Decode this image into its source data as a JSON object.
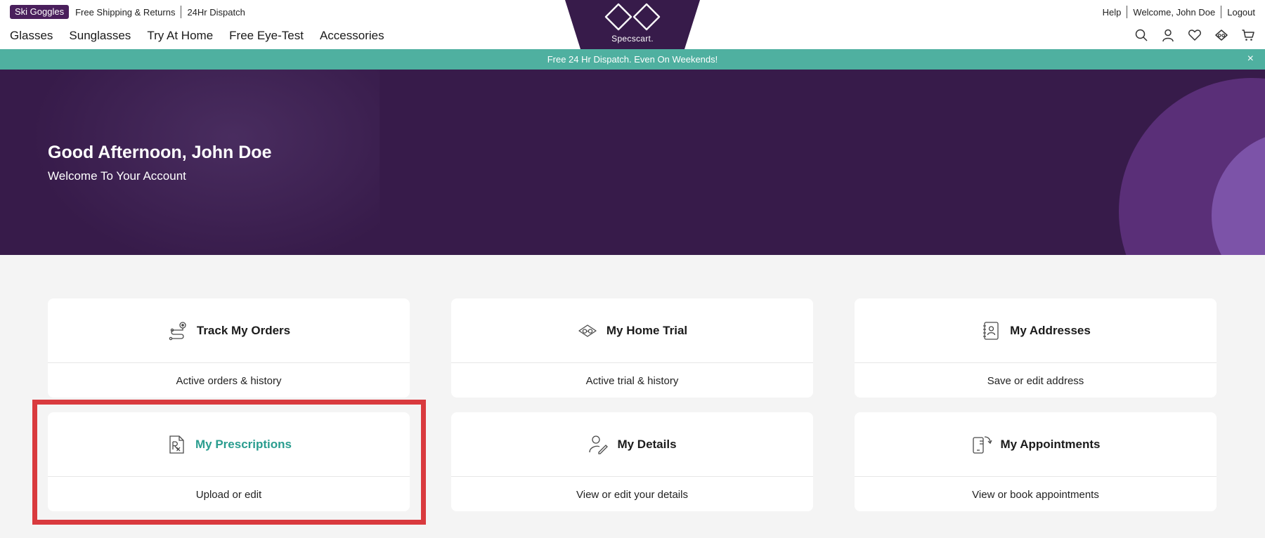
{
  "topbar": {
    "promo_tag": "Ski Goggles",
    "shipping": "Free Shipping & Returns",
    "dispatch": "24Hr Dispatch"
  },
  "topright": {
    "help": "Help",
    "welcome": "Welcome, John Doe",
    "logout": "Logout"
  },
  "nav": [
    "Glasses",
    "Sunglasses",
    "Try At Home",
    "Free Eye-Test",
    "Accessories"
  ],
  "logo": {
    "text": "Specscart."
  },
  "icons": [
    "search-icon",
    "user-icon",
    "heart-icon",
    "home-trial-icon",
    "cart-icon"
  ],
  "announcement": {
    "text": "Free 24 Hr Dispatch. Even On Weekends!",
    "close": "×"
  },
  "hero": {
    "title": "Good Afternoon, John Doe",
    "subtitle": "Welcome To Your Account"
  },
  "cards": [
    {
      "title": "Track My Orders",
      "desc": "Active orders & history",
      "icon": "route-icon"
    },
    {
      "title": "My Home Trial",
      "desc": "Active trial & history",
      "icon": "glasses-box-icon"
    },
    {
      "title": "My Addresses",
      "desc": "Save or edit address",
      "icon": "address-book-icon"
    },
    {
      "title": "My Prescriptions",
      "desc": "Upload or edit",
      "icon": "prescription-icon",
      "active": true
    },
    {
      "title": "My Details",
      "desc": "View or edit your details",
      "icon": "user-edit-icon"
    },
    {
      "title": "My Appointments",
      "desc": "View or book appointments",
      "icon": "phone-calendar-icon"
    }
  ],
  "colors": {
    "brand_purple": "#371b4a",
    "teal": "#4fb0a0",
    "active_teal": "#2a9d8f",
    "highlight_red": "#d93a3e"
  }
}
